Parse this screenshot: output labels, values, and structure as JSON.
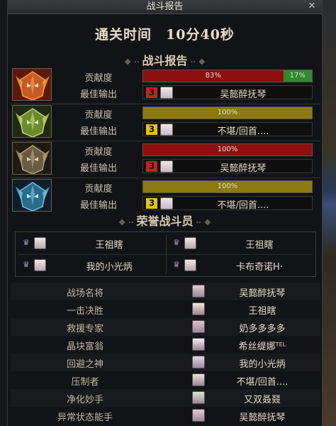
{
  "window": {
    "title": "战斗报告",
    "close_glyph": "✕"
  },
  "clear_time": "通关时间　10分40秒",
  "battle_report": {
    "title": "战斗报告",
    "contribution_label": "贡献度",
    "best_output_label": "最佳输出",
    "players": [
      {
        "avatar_icon": "fire-mask-icon",
        "bars": [
          {
            "text": "83%",
            "percent": 83,
            "color": "#8e0f0f"
          },
          {
            "text": "17%",
            "percent": 17,
            "color": "#2f8a2a"
          }
        ],
        "rank": "3",
        "rank_color": "red",
        "best_output": "吴懿醉抚琴"
      },
      {
        "avatar_icon": "nature-mask-icon",
        "bars": [
          {
            "text": "100%",
            "percent": 100,
            "color": "#8a7a10"
          }
        ],
        "rank": "3",
        "rank_color": "yellow",
        "best_output": "不堪/回首...."
      },
      {
        "avatar_icon": "stone-mask-icon",
        "bars": [
          {
            "text": "100%",
            "percent": 100,
            "color": "#8e0f0f"
          }
        ],
        "rank": "3",
        "rank_color": "red",
        "best_output": "吴懿醉抚琴"
      },
      {
        "avatar_icon": "ice-mask-icon",
        "bars": [
          {
            "text": "100%",
            "percent": 100,
            "color": "#8a7a10"
          }
        ],
        "rank": "3",
        "rank_color": "yellow",
        "best_output": "不堪/回首...."
      }
    ]
  },
  "honor": {
    "title": "荣誉战斗员",
    "members": [
      "王祖瞎",
      "王祖瞎",
      "我的小光炳",
      "卡布奇诺H·"
    ]
  },
  "awards": [
    {
      "title": "战场名将",
      "player": "吴懿醉抚琴"
    },
    {
      "title": "一击决胜",
      "player": "王祖瞎"
    },
    {
      "title": "救援专家",
      "player": "奶多多多多"
    },
    {
      "title": "晶块富翁",
      "player": "希丝缇娜ᵀᴱᴸ"
    },
    {
      "title": "回避之神",
      "player": "我的小光炳"
    },
    {
      "title": "压制者",
      "player": "不堪/回首...."
    },
    {
      "title": "净化妙手",
      "player": "又双叒叕"
    },
    {
      "title": "异常状态能手",
      "player": "吴懿醉抚琴"
    }
  ]
}
